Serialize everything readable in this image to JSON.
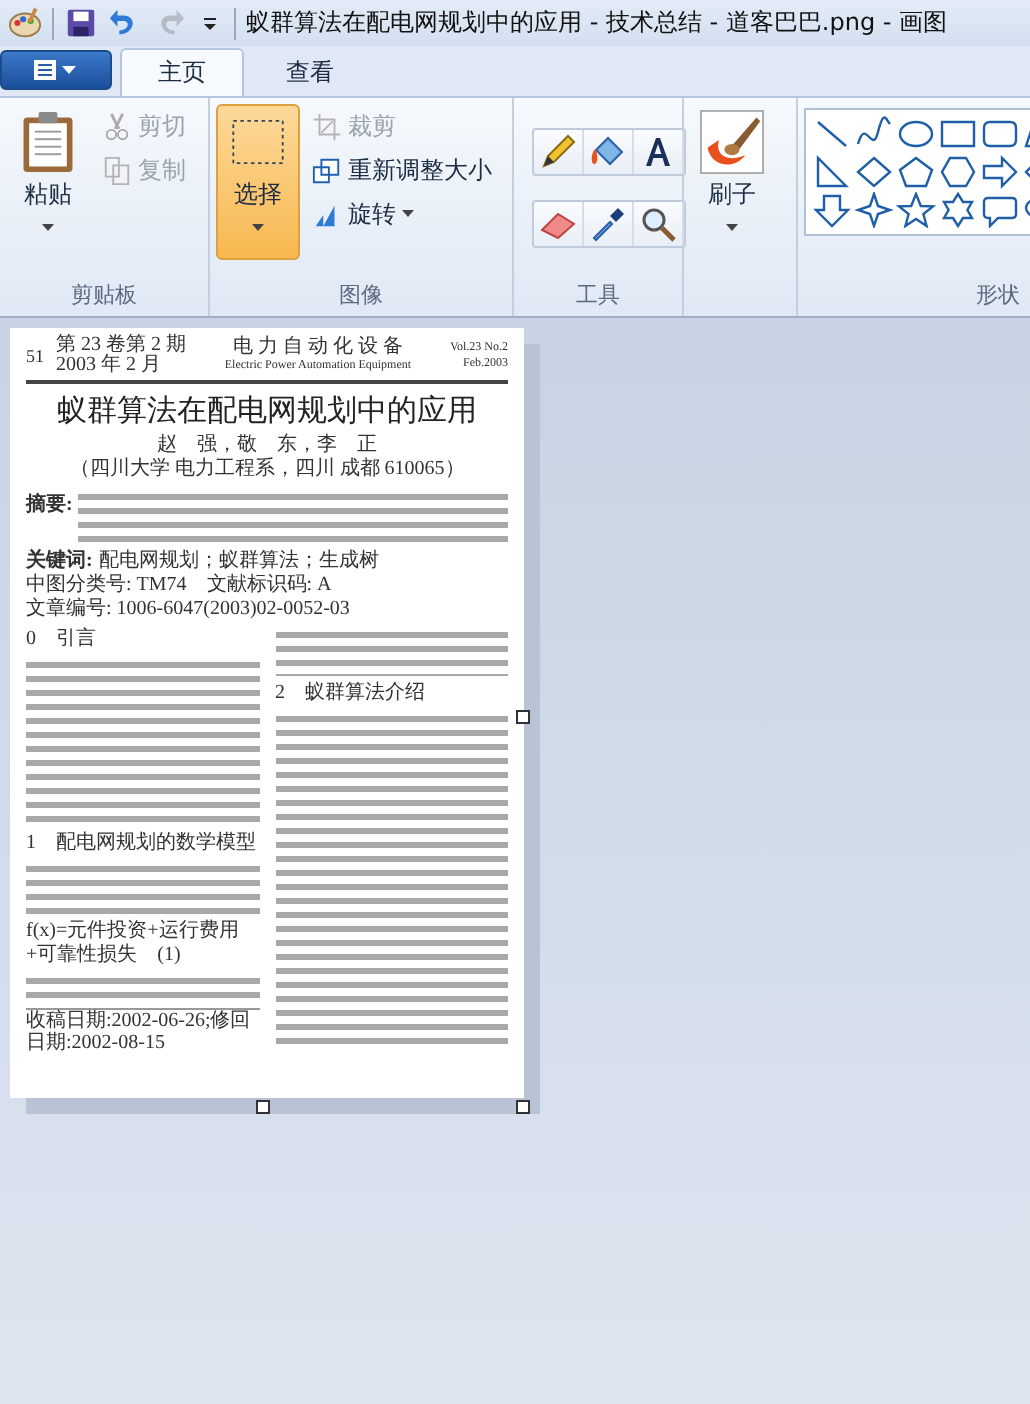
{
  "window": {
    "title": "蚁群算法在配电网规划中的应用 - 技术总结 - 道客巴巴.png - 画图"
  },
  "quick_access": [
    {
      "kind": "save",
      "disabled": false
    },
    {
      "kind": "undo",
      "disabled": false
    },
    {
      "kind": "redo",
      "disabled": true
    },
    {
      "kind": "customize",
      "disabled": false
    }
  ],
  "tabs": [
    {
      "label": "主页",
      "selected": true
    },
    {
      "label": "查看",
      "selected": false
    }
  ],
  "ribbon": {
    "groups": [
      {
        "kind": "clipboard",
        "label": "剪贴板",
        "items": [
          {
            "kind": "large",
            "label": "粘贴",
            "selected": false
          },
          {
            "kind": "small",
            "label": "剪切",
            "disabled": true
          },
          {
            "kind": "small",
            "label": "复制",
            "disabled": true
          }
        ]
      },
      {
        "kind": "image",
        "label": "图像",
        "items": [
          {
            "kind": "large",
            "label": "选择",
            "selected": true
          },
          {
            "kind": "small",
            "label": "裁剪",
            "disabled": true
          },
          {
            "kind": "small",
            "label": "重新调整大小",
            "disabled": false
          },
          {
            "kind": "small",
            "label": "旋转",
            "disabled": false
          }
        ]
      },
      {
        "kind": "tools",
        "label": "工具"
      },
      {
        "kind": "brush",
        "items": [
          {
            "kind": "large",
            "label": "刷子",
            "selected": false
          }
        ]
      },
      {
        "kind": "shapes",
        "label": "形状"
      }
    ]
  },
  "document": {
    "header": {
      "page": "51",
      "issue": "第 23 卷第 2 期",
      "date": "2003 年 2 月",
      "journal": "电 力 自 动 化 设 备",
      "journal_en": "Electric Power Automation Equipment",
      "volume": "Vol.23 No.2",
      "date_en": "Feb.2003"
    },
    "title": "蚁群算法在配电网规划中的应用",
    "authors": "赵　强，敬　东，李　正",
    "affiliation": "（四川大学 电力工程系，四川 成都 610065）",
    "abstract_label": "摘要:",
    "keywords_label": "关键词:",
    "keywords": "配电网规划；蚁群算法；生成树",
    "meta": [
      "中图分类号: TM74",
      "文献标识码: A",
      "文章编号: 1006-6047(2003)02-0052-03"
    ],
    "columns": [
      [
        {
          "kind": "heading",
          "text": "0　引言"
        },
        {
          "kind": "paragraph"
        },
        {
          "kind": "heading",
          "text": "1　配电网规划的数学模型"
        },
        {
          "kind": "paragraph"
        },
        {
          "kind": "formula",
          "text": "f(x)=元件投资+运行费用+可靠性损失　(1)"
        },
        {
          "kind": "paragraph"
        },
        {
          "kind": "footnote",
          "text": "收稿日期:2002-06-26;修回日期:2002-08-15"
        }
      ],
      [
        {
          "kind": "paragraph"
        },
        {
          "kind": "heading",
          "text": "2　蚁群算法介绍"
        },
        {
          "kind": "paragraph"
        }
      ]
    ]
  }
}
